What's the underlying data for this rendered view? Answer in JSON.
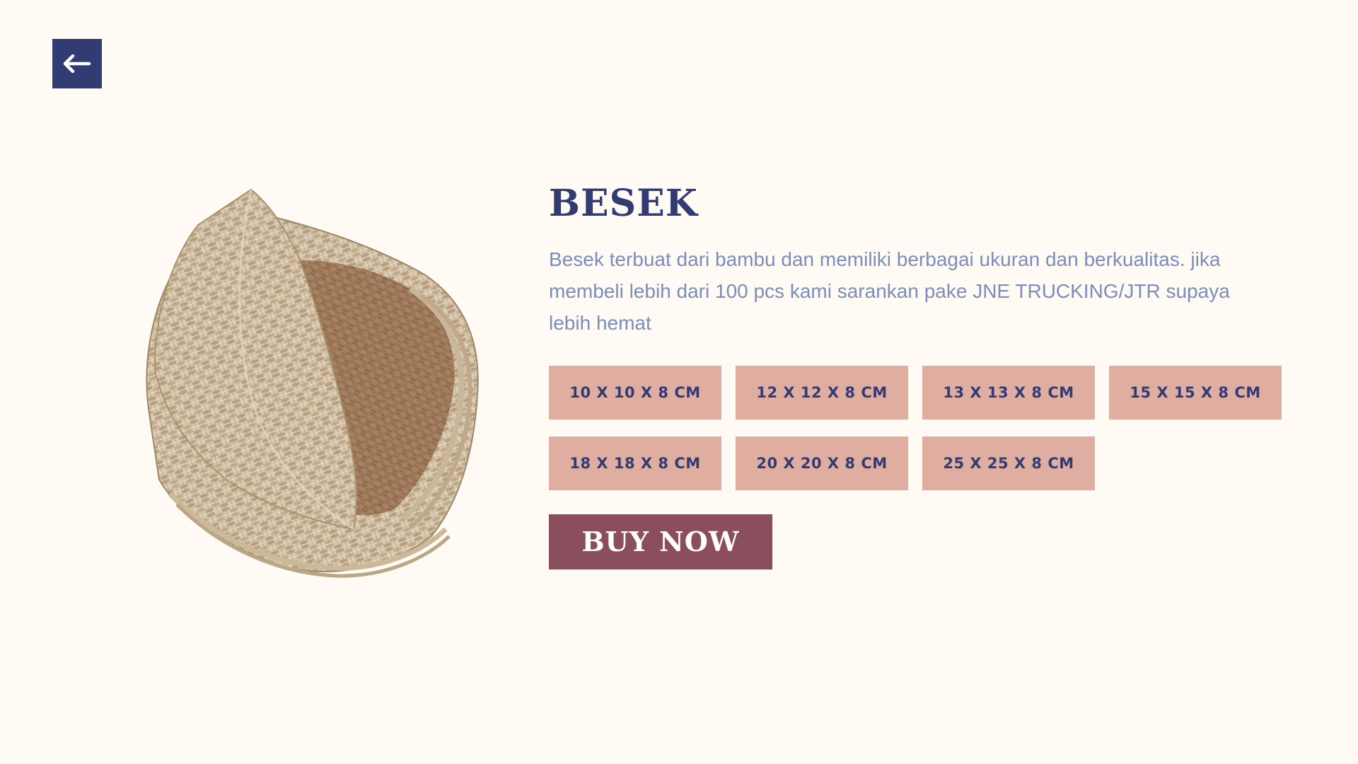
{
  "nav": {
    "back_icon": "arrow-left-icon",
    "accent_color": "#323c72"
  },
  "product": {
    "image": "woven-bamboo-basket",
    "title": "BESEK",
    "description": "Besek terbuat dari bambu dan memiliki berbagai ukuran dan berkualitas. jika membeli lebih dari 100 pcs kami sarankan pake JNE TRUCKING/JTR supaya lebih hemat",
    "sizes": [
      "10 X 10 X 8 CM",
      "12 X 12 X 8 CM",
      "13 X 13 X 8 CM",
      "15 X 15 X 8 CM",
      "18 X 18 X 8 CM",
      "20 X 20 X 8 CM",
      "25 X 25 X 8 CM"
    ],
    "size_button_color": "#e0aea0",
    "buy_label": "BUY NOW",
    "buy_button_color": "#8a4e5c"
  }
}
